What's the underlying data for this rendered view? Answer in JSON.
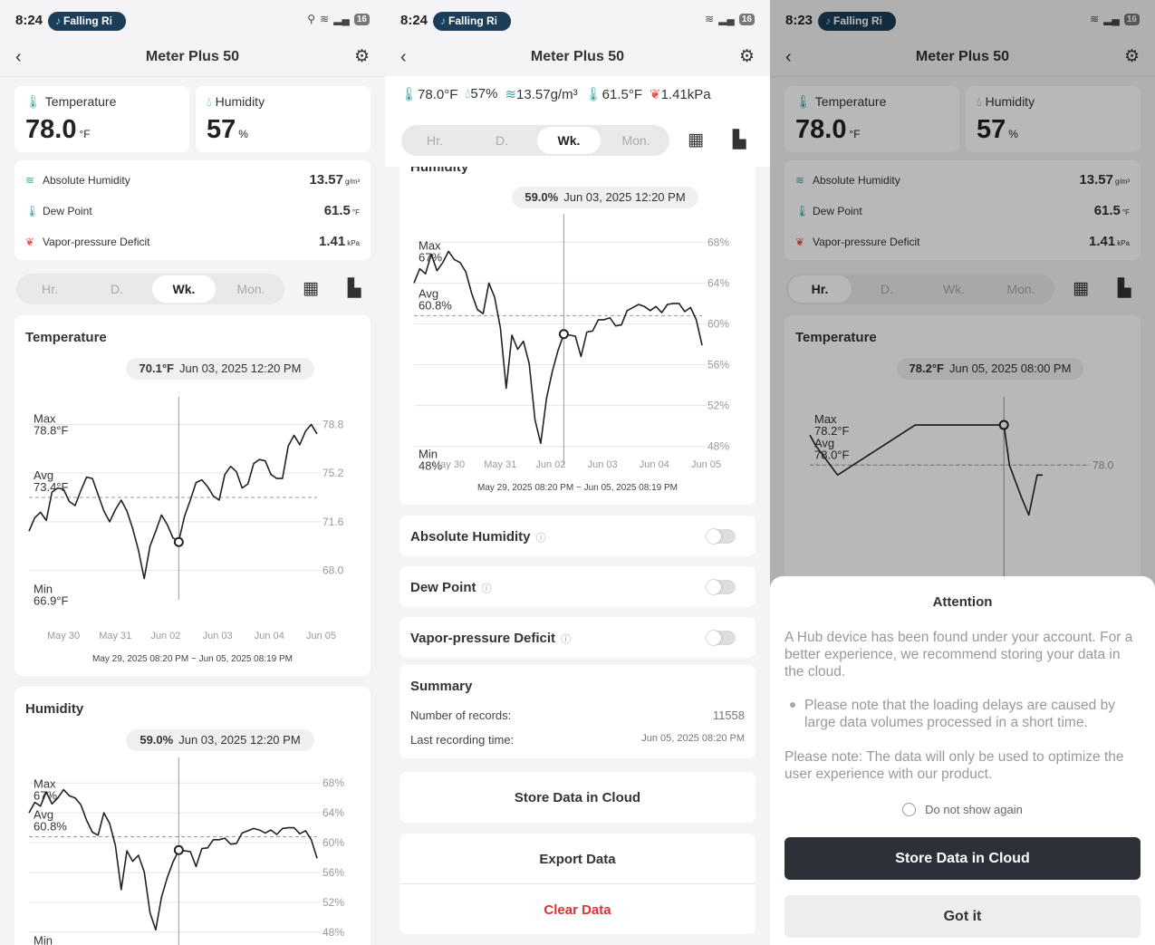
{
  "status": {
    "time_1": "8:24",
    "time_2": "8:24",
    "time_3": "8:23",
    "media_pill": "Falling Ri",
    "battery": "16"
  },
  "device": {
    "title": "Meter Plus 50"
  },
  "readings": {
    "temperature_label": "Temperature",
    "temperature_value": "78.0",
    "temperature_unit": "°F",
    "humidity_label": "Humidity",
    "humidity_value": "57",
    "humidity_unit": "%",
    "abs_humidity_label": "Absolute Humidity",
    "abs_humidity_value": "13.57",
    "abs_humidity_unit": "g/m³",
    "dew_point_label": "Dew Point",
    "dew_point_value": "61.5",
    "dew_point_unit": "°F",
    "vpd_label": "Vapor-pressure Deficit",
    "vpd_value": "1.41",
    "vpd_unit": "kPa"
  },
  "inline_readings": {
    "temp": "78.0°F",
    "hum": "57%",
    "abs": "13.57g/m³",
    "dew": "61.5°F",
    "vpd": "1.41kPa"
  },
  "tabs": {
    "hr": "Hr.",
    "day": "D.",
    "week": "Wk.",
    "month": "Mon."
  },
  "temp_chart_card": {
    "title": "Temperature",
    "tooltip_value": "70.1°F",
    "tooltip_time": "Jun 03, 2025 12:20 PM",
    "range": "May 29, 2025 08:20 PM ~ Jun 05, 2025 08:19 PM"
  },
  "hum_chart_card": {
    "title": "Humidity",
    "title_partial": "Humidity",
    "tooltip_value": "59.0%",
    "tooltip_time": "Jun 03, 2025 12:20 PM",
    "range": "May 29, 2025 08:20 PM ~ Jun 05, 2025 08:19 PM"
  },
  "hr_chart_card": {
    "title": "Temperature",
    "tooltip_value": "78.2°F",
    "tooltip_time": "Jun 05, 2025 08:00 PM"
  },
  "toggles": {
    "abs": "Absolute Humidity",
    "dew": "Dew Point",
    "vpd": "Vapor-pressure Deficit"
  },
  "summary": {
    "title": "Summary",
    "records_label": "Number of records:",
    "records_value": "11558",
    "last_label": "Last recording time:",
    "last_value": "Jun 05, 2025 08:20 PM"
  },
  "actions": {
    "store": "Store Data in Cloud",
    "export": "Export Data",
    "clear": "Clear Data"
  },
  "dialog": {
    "title": "Attention",
    "para1": "A Hub device has been found under your account. For a better experience, we recommend storing your data in the cloud.",
    "bullet": "Please note that the loading delays are caused by large data volumes processed in a short time.",
    "para2": "Please note: The data will only be used to optimize the user experience with our product.",
    "checkbox": "Do not show again",
    "primary": "Store Data in Cloud",
    "secondary": "Got it"
  },
  "colors": {
    "accent_teal": "#3aa6a0",
    "danger": "#e03131",
    "dark_button": "#2d3037",
    "media_pill": "#1d3d58"
  },
  "chart_data": [
    {
      "id": "temperature_week",
      "type": "line",
      "title": "Temperature",
      "x_ticks": [
        "May 30",
        "May 31",
        "Jun 02",
        "Jun 03",
        "Jun 04",
        "Jun 05"
      ],
      "y_ticks": [
        "78.8",
        "75.2",
        "71.6",
        "68.0"
      ],
      "ylim": [
        66.5,
        79.5
      ],
      "max_label": "Max",
      "max_value": "78.8°F",
      "avg_label": "Avg",
      "avg_value": "73.4°F",
      "min_label": "Min",
      "min_value": "66.9°F",
      "avg": 73.4,
      "x": [
        0,
        0.02,
        0.04,
        0.06,
        0.08,
        0.1,
        0.12,
        0.14,
        0.16,
        0.18,
        0.2,
        0.22,
        0.24,
        0.26,
        0.28,
        0.3,
        0.32,
        0.34,
        0.36,
        0.38,
        0.4,
        0.42,
        0.44,
        0.46,
        0.48,
        0.5,
        0.52,
        0.54,
        0.56,
        0.58,
        0.6,
        0.62,
        0.64,
        0.66,
        0.68,
        0.7,
        0.72,
        0.74,
        0.76,
        0.78,
        0.8,
        0.82,
        0.84,
        0.86,
        0.88,
        0.9,
        0.92,
        0.94,
        0.96,
        0.98,
        1.0
      ],
      "values": [
        70.9,
        71.9,
        72.3,
        71.7,
        73.8,
        74.1,
        74.0,
        73.1,
        72.8,
        73.9,
        74.9,
        74.8,
        73.6,
        72.4,
        71.6,
        72.5,
        73.2,
        72.4,
        71.1,
        69.5,
        67.4,
        69.8,
        70.9,
        72.1,
        71.4,
        70.4,
        70.2,
        72.0,
        73.2,
        74.5,
        74.7,
        74.2,
        73.5,
        73.2,
        75.1,
        75.7,
        75.3,
        74.1,
        74.4,
        75.9,
        76.2,
        76.1,
        75.1,
        74.8,
        74.8,
        77.2,
        78.0,
        77.3,
        78.3,
        78.8,
        78.1
      ],
      "selected_x": 0.52,
      "selected_value": 70.1
    },
    {
      "id": "humidity_week",
      "type": "line",
      "title": "Humidity",
      "x_ticks": [
        "May 30",
        "May 31",
        "Jun 02",
        "Jun 03",
        "Jun 04",
        "Jun 05"
      ],
      "y_ticks": [
        "68%",
        "64%",
        "60%",
        "56%",
        "52%",
        "48%"
      ],
      "ylim": [
        47,
        69
      ],
      "max_label": "Max",
      "max_value": "67%",
      "avg_label": "Avg",
      "avg_value": "60.8%",
      "min_label": "Min",
      "min_value": "48%",
      "avg": 60.8,
      "x": [
        0,
        0.02,
        0.04,
        0.06,
        0.08,
        0.1,
        0.12,
        0.14,
        0.16,
        0.18,
        0.2,
        0.22,
        0.24,
        0.26,
        0.28,
        0.3,
        0.32,
        0.34,
        0.36,
        0.38,
        0.4,
        0.42,
        0.44,
        0.46,
        0.48,
        0.5,
        0.52,
        0.54,
        0.56,
        0.58,
        0.6,
        0.62,
        0.64,
        0.66,
        0.68,
        0.7,
        0.72,
        0.74,
        0.76,
        0.78,
        0.8,
        0.82,
        0.84,
        0.86,
        0.88,
        0.9,
        0.92,
        0.94,
        0.96,
        0.98,
        1.0
      ],
      "values": [
        64.0,
        65.4,
        64.9,
        66.8,
        65.2,
        66.0,
        67.1,
        66.3,
        66.0,
        65.1,
        63.0,
        61.4,
        61.0,
        64.0,
        62.6,
        59.6,
        53.7,
        58.9,
        57.5,
        58.3,
        56.1,
        50.6,
        48.3,
        52.7,
        55.3,
        57.4,
        59.0,
        58.9,
        58.8,
        56.8,
        59.2,
        59.3,
        60.4,
        60.4,
        60.6,
        59.8,
        59.9,
        61.3,
        61.6,
        61.9,
        61.7,
        61.3,
        61.7,
        61.1,
        61.9,
        62.0,
        62.0,
        61.2,
        61.6,
        60.4,
        57.9
      ],
      "selected_x": 0.52,
      "selected_value": 59.0
    },
    {
      "id": "temperature_hour",
      "type": "line",
      "title": "Temperature",
      "y_ticks": [
        "78.0"
      ],
      "max_label": "Max",
      "max_value": "78.2°F",
      "avg_label": "Avg",
      "avg_value": "78.0°F",
      "avg": 78.0,
      "x": [
        0.0,
        0.02,
        0.1,
        0.38,
        0.7,
        0.72,
        0.76,
        0.79,
        0.82,
        0.84
      ],
      "values": [
        78.15,
        78.1,
        77.95,
        78.2,
        78.2,
        78.0,
        77.85,
        77.75,
        77.95,
        77.95
      ],
      "selected_x": 0.7,
      "selected_value": 78.2
    }
  ]
}
